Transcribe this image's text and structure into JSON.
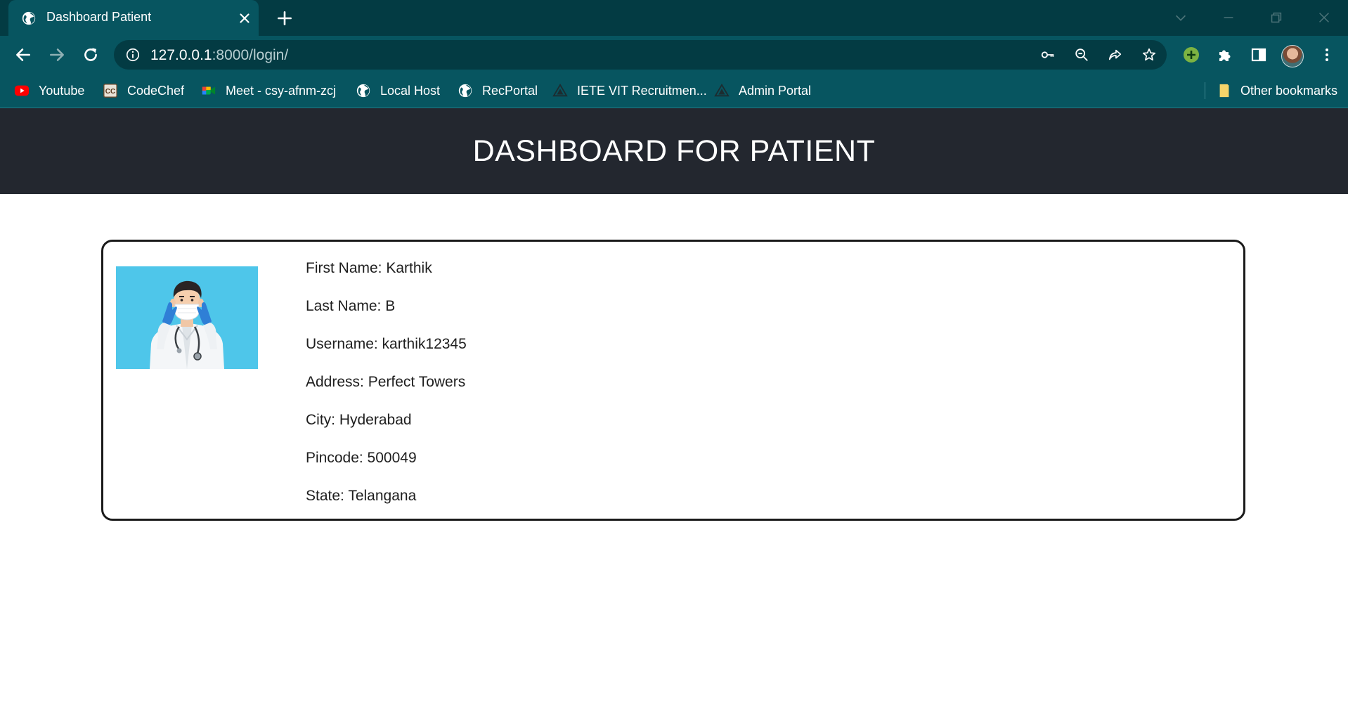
{
  "browser": {
    "tab_title": "Dashboard Patient",
    "url_host": "127.0.0.1",
    "url_path": ":8000/login/",
    "bookmarks": [
      {
        "label": "Youtube",
        "icon": "youtube-icon"
      },
      {
        "label": "CodeChef",
        "icon": "codechef-icon"
      },
      {
        "label": "Meet - csy-afnm-zcj",
        "icon": "meet-icon"
      },
      {
        "label": "Local Host",
        "icon": "globe-icon"
      },
      {
        "label": "RecPortal",
        "icon": "globe-icon"
      },
      {
        "label": "IETE VIT Recruitmen...",
        "icon": "triangle-logo-icon"
      },
      {
        "label": "Admin Portal",
        "icon": "triangle-logo-icon"
      }
    ],
    "other_bookmarks": "Other bookmarks",
    "colors": {
      "tabstrip": "#033b43",
      "toolbar": "#075560"
    }
  },
  "page": {
    "header_title": "DASHBOARD FOR PATIENT",
    "profile_image": "doctor-avatar-illustration",
    "fields": [
      {
        "label": "First Name: Karthik"
      },
      {
        "label": "Last Name: B"
      },
      {
        "label": "Username: karthik12345"
      },
      {
        "label": "Address: Perfect Towers"
      },
      {
        "label": "City: Hyderabad"
      },
      {
        "label": "Pincode: 500049"
      },
      {
        "label": "State: Telangana"
      }
    ],
    "colors": {
      "header_bg": "#23272f",
      "photo_bg": "#4ec6ea"
    }
  }
}
